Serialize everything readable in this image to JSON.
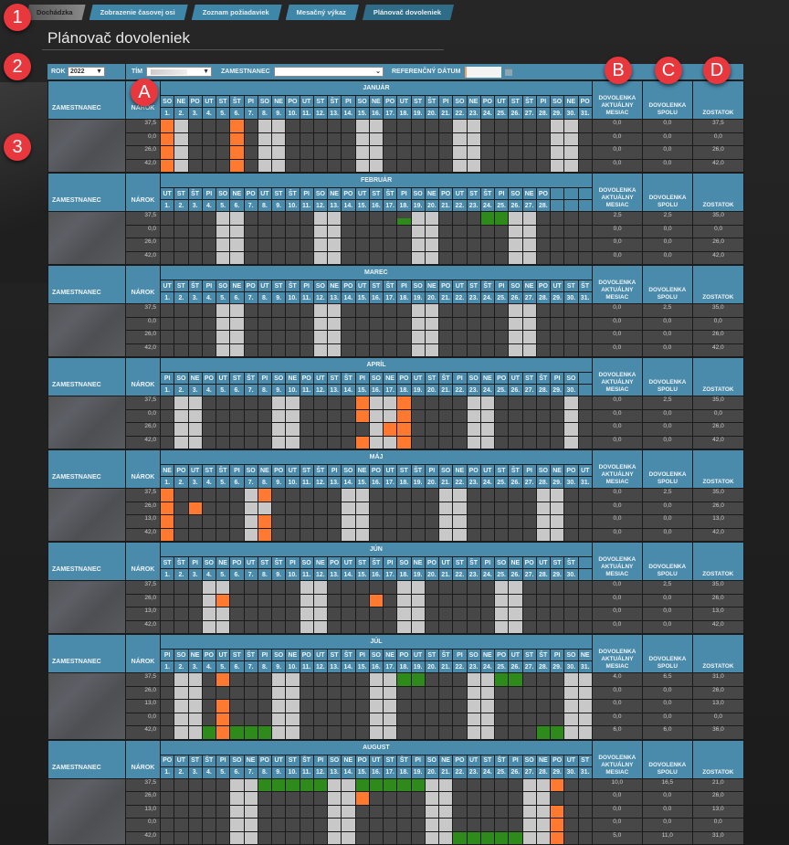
{
  "tabs": [
    "Dochádzka",
    "Zobrazenie časovej osi",
    "Zoznam požiadaviek",
    "Mesačný výkaz",
    "Plánovač dovoleniek"
  ],
  "title": "Plánovač dovoleniek",
  "filters": {
    "year_label": "ROK",
    "year": "2022",
    "team_label": "TÍM",
    "employee_label": "ZAMESTNANEC",
    "employee_value": "",
    "ref_date_label": "REFERENČNÝ DÁTUM"
  },
  "columns": {
    "employee": "ZAMESTNANEC",
    "entitlement": "NÁROK",
    "month_leave": "DOVOLENKA AKTUÁLNY MESIAC",
    "total_leave": "DOVOLENKA SPOLU",
    "remaining": "ZOSTATOK"
  },
  "annotations": {
    "n1": "1",
    "n2": "2",
    "n3": "3",
    "a": "A",
    "b": "B",
    "c": "C",
    "d": "D"
  },
  "colors": {
    "header": "#4a8aab",
    "cell": "#474747",
    "weekend": "#c8c8c8",
    "holiday": "#ff7a30",
    "leave": "#2f8a1c",
    "badge": "#e8383d"
  },
  "months": [
    {
      "name": "JANUÁR",
      "days": [
        "SO",
        "NE",
        "PO",
        "UT",
        "ST",
        "ŠT",
        "PI",
        "SO",
        "NE",
        "PO",
        "UT",
        "ST",
        "ŠT",
        "PI",
        "SO",
        "NE",
        "PO",
        "UT",
        "ST",
        "ŠT",
        "PI",
        "SO",
        "NE",
        "PO",
        "UT",
        "ST",
        "ŠT",
        "PI",
        "SO",
        "NE",
        "PO"
      ],
      "rows": [
        {
          "narok": "37,5",
          "month": "0,0",
          "total": "0,0",
          "remaining": "37,5",
          "orange": [
            1,
            6
          ],
          "green": [],
          "half_green": []
        },
        {
          "narok": "0,0",
          "month": "0,0",
          "total": "0,0",
          "remaining": "0,0",
          "orange": [
            1,
            6
          ],
          "green": [],
          "half_green": []
        },
        {
          "narok": "26,0",
          "month": "0,0",
          "total": "0,0",
          "remaining": "26,0",
          "orange": [
            1,
            6
          ],
          "green": [],
          "half_green": []
        },
        {
          "narok": "42,0",
          "month": "0,0",
          "total": "0,0",
          "remaining": "42,0",
          "orange": [
            1,
            6
          ],
          "green": [],
          "half_green": []
        }
      ]
    },
    {
      "name": "FEBRUÁR",
      "days": [
        "UT",
        "ST",
        "ŠT",
        "PI",
        "SO",
        "NE",
        "PO",
        "UT",
        "ST",
        "ŠT",
        "PI",
        "SO",
        "NE",
        "PO",
        "UT",
        "ST",
        "ŠT",
        "PI",
        "SO",
        "NE",
        "PO",
        "UT",
        "ST",
        "ŠT",
        "PI",
        "SO",
        "NE",
        "PO"
      ],
      "rows": [
        {
          "narok": "37,5",
          "month": "2,5",
          "total": "2,5",
          "remaining": "35,0",
          "orange": [],
          "green": [
            24,
            25
          ],
          "half_green": [
            18
          ]
        },
        {
          "narok": "0,0",
          "month": "0,0",
          "total": "0,0",
          "remaining": "0,0",
          "orange": [],
          "green": [],
          "half_green": []
        },
        {
          "narok": "26,0",
          "month": "0,0",
          "total": "0,0",
          "remaining": "26,0",
          "orange": [],
          "green": [],
          "half_green": []
        },
        {
          "narok": "42,0",
          "month": "0,0",
          "total": "0,0",
          "remaining": "42,0",
          "orange": [],
          "green": [],
          "half_green": []
        }
      ]
    },
    {
      "name": "MAREC",
      "days": [
        "UT",
        "ST",
        "ŠT",
        "PI",
        "SO",
        "NE",
        "PO",
        "UT",
        "ST",
        "ŠT",
        "PI",
        "SO",
        "NE",
        "PO",
        "UT",
        "ST",
        "ŠT",
        "PI",
        "SO",
        "NE",
        "PO",
        "UT",
        "ST",
        "ŠT",
        "PI",
        "SO",
        "NE",
        "PO",
        "UT",
        "ST",
        "ŠT"
      ],
      "rows": [
        {
          "narok": "37,5",
          "month": "0,0",
          "total": "2,5",
          "remaining": "35,0",
          "orange": [],
          "green": [],
          "half_green": []
        },
        {
          "narok": "0,0",
          "month": "0,0",
          "total": "0,0",
          "remaining": "0,0",
          "orange": [],
          "green": [],
          "half_green": []
        },
        {
          "narok": "26,0",
          "month": "0,0",
          "total": "0,0",
          "remaining": "26,0",
          "orange": [],
          "green": [],
          "half_green": []
        },
        {
          "narok": "42,0",
          "month": "0,0",
          "total": "0,0",
          "remaining": "42,0",
          "orange": [],
          "green": [],
          "half_green": []
        }
      ]
    },
    {
      "name": "APRÍL",
      "days": [
        "PI",
        "SO",
        "NE",
        "PO",
        "UT",
        "ST",
        "ŠT",
        "PI",
        "SO",
        "NE",
        "PO",
        "UT",
        "ST",
        "ŠT",
        "PI",
        "SO",
        "NE",
        "PO",
        "UT",
        "ST",
        "ŠT",
        "PI",
        "SO",
        "NE",
        "PO",
        "UT",
        "ST",
        "ŠT",
        "PI",
        "SO"
      ],
      "rows": [
        {
          "narok": "37,5",
          "month": "0,0",
          "total": "2,5",
          "remaining": "35,0",
          "orange": [
            15,
            18
          ],
          "green": [],
          "half_green": []
        },
        {
          "narok": "0,0",
          "month": "0,0",
          "total": "0,0",
          "remaining": "0,0",
          "orange": [
            15,
            18
          ],
          "green": [],
          "half_green": []
        },
        {
          "narok": "26,0",
          "month": "0,0",
          "total": "0,0",
          "remaining": "26,0",
          "orange": [
            17,
            18
          ],
          "green": [],
          "half_green": []
        },
        {
          "narok": "42,0",
          "month": "0,0",
          "total": "0,0",
          "remaining": "42,0",
          "orange": [
            15,
            18
          ],
          "green": [],
          "half_green": []
        }
      ]
    },
    {
      "name": "MÁJ",
      "days": [
        "NE",
        "PO",
        "UT",
        "ST",
        "ŠT",
        "PI",
        "SO",
        "NE",
        "PO",
        "UT",
        "ST",
        "ŠT",
        "PI",
        "SO",
        "NE",
        "PO",
        "UT",
        "ST",
        "ŠT",
        "PI",
        "SO",
        "NE",
        "PO",
        "UT",
        "ST",
        "ŠT",
        "PI",
        "SO",
        "NE",
        "PO",
        "UT"
      ],
      "rows": [
        {
          "narok": "37,5",
          "month": "0,0",
          "total": "2,5",
          "remaining": "35,0",
          "orange": [
            1,
            8
          ],
          "green": [],
          "half_green": []
        },
        {
          "narok": "26,0",
          "month": "0,0",
          "total": "0,0",
          "remaining": "26,0",
          "orange": [
            1,
            3
          ],
          "green": [],
          "half_green": []
        },
        {
          "narok": "13,0",
          "month": "0,0",
          "total": "0,0",
          "remaining": "13,0",
          "orange": [
            1,
            8
          ],
          "green": [],
          "half_green": []
        },
        {
          "narok": "42,0",
          "month": "0,0",
          "total": "0,0",
          "remaining": "42,0",
          "orange": [
            1,
            8
          ],
          "green": [],
          "half_green": []
        }
      ]
    },
    {
      "name": "JÚN",
      "days": [
        "ST",
        "ŠT",
        "PI",
        "SO",
        "NE",
        "PO",
        "UT",
        "ST",
        "ŠT",
        "PI",
        "SO",
        "NE",
        "PO",
        "UT",
        "ST",
        "ŠT",
        "PI",
        "SO",
        "NE",
        "PO",
        "UT",
        "ST",
        "ŠT",
        "PI",
        "SO",
        "NE",
        "PO",
        "UT",
        "ST",
        "ŠT"
      ],
      "rows": [
        {
          "narok": "37,5",
          "month": "0,0",
          "total": "2,5",
          "remaining": "35,0",
          "orange": [],
          "green": [],
          "half_green": []
        },
        {
          "narok": "26,0",
          "month": "0,0",
          "total": "0,0",
          "remaining": "26,0",
          "orange": [
            5,
            16
          ],
          "green": [],
          "half_green": []
        },
        {
          "narok": "13,0",
          "month": "0,0",
          "total": "0,0",
          "remaining": "13,0",
          "orange": [],
          "green": [],
          "half_green": []
        },
        {
          "narok": "42,0",
          "month": "0,0",
          "total": "0,0",
          "remaining": "42,0",
          "orange": [],
          "green": [],
          "half_green": []
        }
      ]
    },
    {
      "name": "JÚL",
      "days": [
        "PI",
        "SO",
        "NE",
        "PO",
        "UT",
        "ST",
        "ŠT",
        "PI",
        "SO",
        "NE",
        "PO",
        "UT",
        "ST",
        "ŠT",
        "PI",
        "SO",
        "NE",
        "PO",
        "UT",
        "ST",
        "ŠT",
        "PI",
        "SO",
        "NE",
        "PO",
        "UT",
        "ST",
        "ŠT",
        "PI",
        "SO",
        "NE"
      ],
      "rows": [
        {
          "narok": "37,5",
          "month": "4,0",
          "total": "6,5",
          "remaining": "31,0",
          "orange": [
            5
          ],
          "green": [
            18,
            19,
            25,
            26
          ],
          "half_green": []
        },
        {
          "narok": "26,0",
          "month": "0,0",
          "total": "0,0",
          "remaining": "26,0",
          "orange": [],
          "green": [],
          "half_green": []
        },
        {
          "narok": "13,0",
          "month": "0,0",
          "total": "0,0",
          "remaining": "13,0",
          "orange": [
            5
          ],
          "green": [],
          "half_green": []
        },
        {
          "narok": "0,0",
          "month": "0,0",
          "total": "0,0",
          "remaining": "0,0",
          "orange": [
            5
          ],
          "green": [],
          "half_green": []
        },
        {
          "narok": "42,0",
          "month": "6,0",
          "total": "6,0",
          "remaining": "36,0",
          "orange": [
            5
          ],
          "green": [
            4,
            6,
            7,
            8,
            28,
            29
          ],
          "half_green": []
        }
      ]
    },
    {
      "name": "AUGUST",
      "days": [
        "PO",
        "UT",
        "ST",
        "ŠT",
        "PI",
        "SO",
        "NE",
        "PO",
        "UT",
        "ST",
        "ŠT",
        "PI",
        "SO",
        "NE",
        "PO",
        "UT",
        "ST",
        "ŠT",
        "PI",
        "SO",
        "NE",
        "PO",
        "UT",
        "ST",
        "ŠT",
        "PI",
        "SO",
        "NE",
        "PO",
        "UT",
        "ST"
      ],
      "rows": [
        {
          "narok": "37,5",
          "month": "10,0",
          "total": "16,5",
          "remaining": "21,0",
          "orange": [
            29
          ],
          "green": [
            8,
            9,
            10,
            11,
            12,
            15,
            16,
            17,
            18,
            19
          ],
          "half_green": []
        },
        {
          "narok": "26,0",
          "month": "0,0",
          "total": "0,0",
          "remaining": "26,0",
          "orange": [
            15
          ],
          "green": [],
          "half_green": []
        },
        {
          "narok": "13,0",
          "month": "0,0",
          "total": "0,0",
          "remaining": "13,0",
          "orange": [
            29
          ],
          "green": [],
          "half_green": []
        },
        {
          "narok": "0,0",
          "month": "0,0",
          "total": "0,0",
          "remaining": "0,0",
          "orange": [
            29
          ],
          "green": [],
          "half_green": []
        },
        {
          "narok": "42,0",
          "month": "5,0",
          "total": "11,0",
          "remaining": "31,0",
          "orange": [
            29
          ],
          "green": [
            22,
            23,
            24,
            25,
            26
          ],
          "half_green": []
        }
      ]
    }
  ]
}
